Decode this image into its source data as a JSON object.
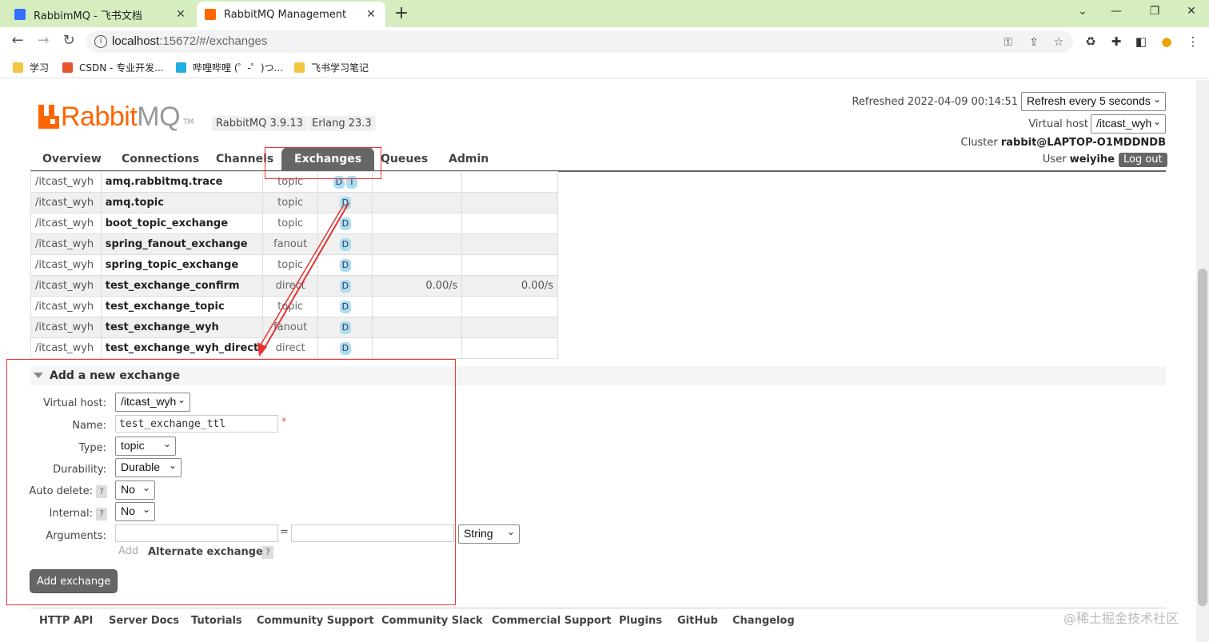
{
  "browser": {
    "tabs": [
      {
        "title": "RabbimMQ - 飞书文档",
        "favicon_color": "#3370ff"
      },
      {
        "title": "RabbitMQ Management",
        "favicon_color": "#ff6600"
      }
    ],
    "new_tab": "+",
    "window_controls": {
      "minimize": "⌄",
      "min": "—",
      "max": "❐",
      "close": "✕"
    },
    "url_host": "localhost",
    "url_rest": ":15672/#/exchanges",
    "bookmarks": [
      {
        "label": "学习",
        "icon_color": "#f4c542"
      },
      {
        "label": "CSDN - 专业开发...",
        "icon_color": "#e4572e"
      },
      {
        "label": "哔哩哔哩 (゜-゜)つ...",
        "icon_color": "#23ade5"
      },
      {
        "label": "飞书学习笔记",
        "icon_color": "#f4c542"
      }
    ]
  },
  "header": {
    "logo_rabbit": "Rabbit",
    "logo_mq": "MQ",
    "logo_tm": "TM",
    "rabbit_version": "RabbitMQ 3.9.13",
    "erlang_version": "Erlang 23.3",
    "refreshed": "Refreshed 2022-04-09 00:14:51",
    "refresh_option": "Refresh every 5 seconds",
    "virtual_host_label": "Virtual host",
    "virtual_host_value": "/itcast_wyh",
    "cluster_label": "Cluster",
    "cluster_value": "rabbit@LAPTOP-O1MDDNDB",
    "user_label": "User",
    "user_value": "weiyihe",
    "logout": "Log out"
  },
  "nav": {
    "items": [
      "Overview",
      "Connections",
      "Channels",
      "Exchanges",
      "Queues",
      "Admin"
    ],
    "active": "Exchanges"
  },
  "exchanges": [
    {
      "vhost": "/itcast_wyh",
      "name": "amq.rabbitmq.trace",
      "type": "topic",
      "features": [
        "D",
        "I"
      ],
      "rate_in": "",
      "rate_out": ""
    },
    {
      "vhost": "/itcast_wyh",
      "name": "amq.topic",
      "type": "topic",
      "features": [
        "D"
      ],
      "rate_in": "",
      "rate_out": ""
    },
    {
      "vhost": "/itcast_wyh",
      "name": "boot_topic_exchange",
      "type": "topic",
      "features": [
        "D"
      ],
      "rate_in": "",
      "rate_out": ""
    },
    {
      "vhost": "/itcast_wyh",
      "name": "spring_fanout_exchange",
      "type": "fanout",
      "features": [
        "D"
      ],
      "rate_in": "",
      "rate_out": ""
    },
    {
      "vhost": "/itcast_wyh",
      "name": "spring_topic_exchange",
      "type": "topic",
      "features": [
        "D"
      ],
      "rate_in": "",
      "rate_out": ""
    },
    {
      "vhost": "/itcast_wyh",
      "name": "test_exchange_confirm",
      "type": "direct",
      "features": [
        "D"
      ],
      "rate_in": "0.00/s",
      "rate_out": "0.00/s"
    },
    {
      "vhost": "/itcast_wyh",
      "name": "test_exchange_topic",
      "type": "topic",
      "features": [
        "D"
      ],
      "rate_in": "",
      "rate_out": ""
    },
    {
      "vhost": "/itcast_wyh",
      "name": "test_exchange_wyh",
      "type": "fanout",
      "features": [
        "D"
      ],
      "rate_in": "",
      "rate_out": ""
    },
    {
      "vhost": "/itcast_wyh",
      "name": "test_exchange_wyh_direct",
      "type": "direct",
      "features": [
        "D"
      ],
      "rate_in": "",
      "rate_out": ""
    }
  ],
  "add_exchange": {
    "title": "Add a new exchange",
    "virtual_host_label": "Virtual host:",
    "virtual_host_value": "/itcast_wyh",
    "name_label": "Name:",
    "name_value": "test_exchange_ttl",
    "required_mark": "*",
    "type_label": "Type:",
    "type_value": "topic",
    "durability_label": "Durability:",
    "durability_value": "Durable",
    "auto_delete_label": "Auto delete:",
    "auto_delete_value": "No",
    "internal_label": "Internal:",
    "internal_value": "No",
    "help": "?",
    "arguments_label": "Arguments:",
    "arguments_eq": "=",
    "arguments_type": "String",
    "add_argument": "Add",
    "alternate_exchange": "Alternate exchange",
    "submit": "Add exchange"
  },
  "footer": {
    "links": [
      "HTTP API",
      "Server Docs",
      "Tutorials",
      "Community Support",
      "Community Slack",
      "Commercial Support",
      "Plugins",
      "GitHub",
      "Changelog"
    ]
  },
  "watermark": "@稀土掘金技术社区",
  "annotation_color": "#e33333"
}
